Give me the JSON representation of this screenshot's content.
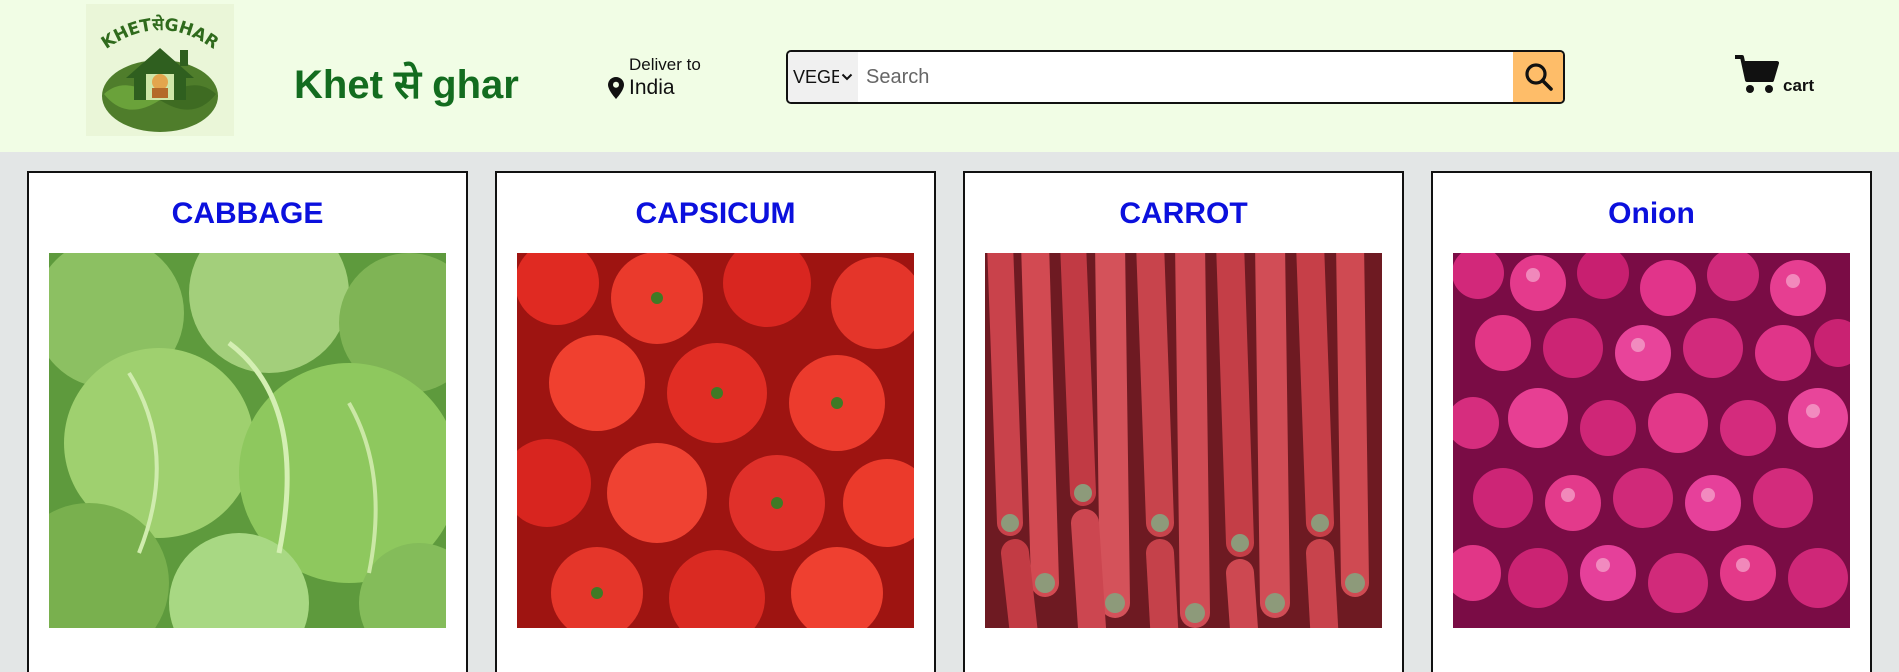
{
  "header": {
    "logo_text": "KHETसेGHAR",
    "site_title": "Khet से ghar",
    "deliver": {
      "label": "Deliver to",
      "location": "India"
    },
    "search": {
      "category": "VEGETABLES",
      "placeholder": "Search"
    },
    "cart_label": "cart"
  },
  "products": [
    {
      "name": "CABBAGE"
    },
    {
      "name": "CAPSICUM"
    },
    {
      "name": "CARROT"
    },
    {
      "name": "Onion"
    }
  ],
  "colors": {
    "header_bg": "#f1fde5",
    "page_bg": "#e3e6e6",
    "title_green": "#136c1f",
    "product_blue": "#0b10dd",
    "search_button": "#febd69"
  }
}
